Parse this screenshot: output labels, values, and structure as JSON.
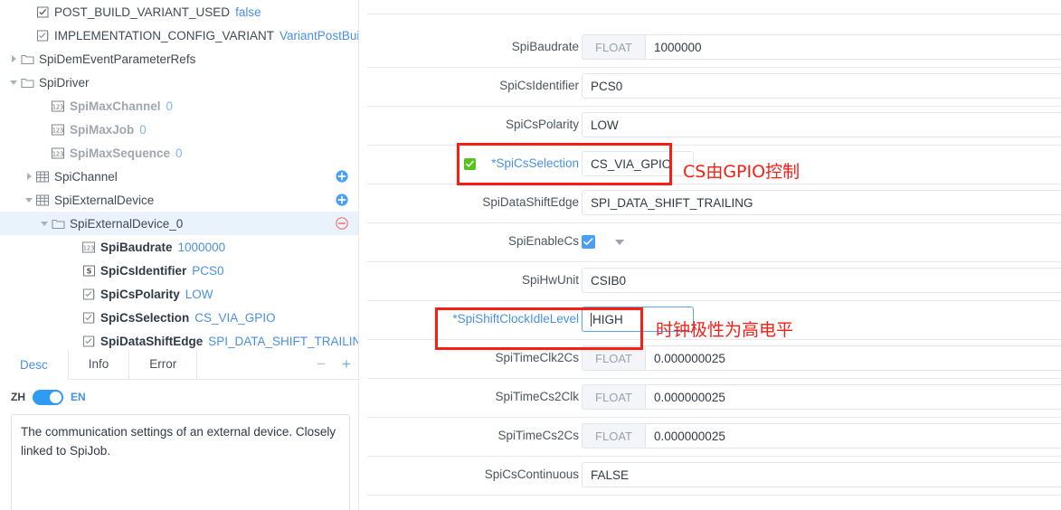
{
  "left_panel": {
    "tree": [
      {
        "indent": 1,
        "twisty": "none",
        "icon": "checkbox-checked-icon",
        "label": "POST_BUILD_VARIANT_USED",
        "value": "false",
        "style": "normal",
        "action": "none"
      },
      {
        "indent": 1,
        "twisty": "none",
        "icon": "enum-icon",
        "label": "IMPLEMENTATION_CONFIG_VARIANT",
        "value": "VariantPostBuild",
        "style": "normal",
        "action": "none"
      },
      {
        "indent": 0,
        "twisty": "right",
        "icon": "folder-icon",
        "label": "SpiDemEventParameterRefs",
        "value": "",
        "style": "normal",
        "action": "none"
      },
      {
        "indent": 0,
        "twisty": "down",
        "icon": "folder-icon",
        "label": "SpiDriver",
        "value": "",
        "style": "normal",
        "action": "none"
      },
      {
        "indent": 2,
        "twisty": "none",
        "icon": "number-icon",
        "label": "SpiMaxChannel",
        "value": "0",
        "style": "muted",
        "action": "none"
      },
      {
        "indent": 2,
        "twisty": "none",
        "icon": "number-icon",
        "label": "SpiMaxJob",
        "value": "0",
        "style": "muted",
        "action": "none"
      },
      {
        "indent": 2,
        "twisty": "none",
        "icon": "number-icon",
        "label": "SpiMaxSequence",
        "value": "0",
        "style": "muted",
        "action": "none"
      },
      {
        "indent": 1,
        "twisty": "right",
        "icon": "table-icon",
        "label": "SpiChannel",
        "value": "",
        "style": "normal",
        "action": "add"
      },
      {
        "indent": 1,
        "twisty": "down",
        "icon": "table-icon",
        "label": "SpiExternalDevice",
        "value": "",
        "style": "normal",
        "action": "add"
      },
      {
        "indent": 2,
        "twisty": "down",
        "icon": "folder-icon",
        "label": "SpiExternalDevice_0",
        "value": "",
        "style": "selected",
        "action": "remove"
      },
      {
        "indent": 4,
        "twisty": "none",
        "icon": "number-icon",
        "label": "SpiBaudrate",
        "value": "1000000",
        "style": "bold",
        "action": "none"
      },
      {
        "indent": 4,
        "twisty": "none",
        "icon": "string-icon",
        "label": "SpiCsIdentifier",
        "value": "PCS0",
        "style": "bold",
        "action": "none"
      },
      {
        "indent": 4,
        "twisty": "none",
        "icon": "enum-icon",
        "label": "SpiCsPolarity",
        "value": "LOW",
        "style": "bold",
        "action": "none"
      },
      {
        "indent": 4,
        "twisty": "none",
        "icon": "enum-icon",
        "label": "SpiCsSelection",
        "value": "CS_VIA_GPIO",
        "style": "bold",
        "action": "none"
      },
      {
        "indent": 4,
        "twisty": "none",
        "icon": "enum-icon",
        "label": "SpiDataShiftEdge",
        "value": "SPI_DATA_SHIFT_TRAILING",
        "style": "bold",
        "action": "none"
      }
    ],
    "tabs": [
      {
        "label": "Desc",
        "active": true
      },
      {
        "label": "Info",
        "active": false
      },
      {
        "label": "Error",
        "active": false
      }
    ],
    "tab_actions": {
      "collapse": "−",
      "expand": "+"
    },
    "language": {
      "left": "ZH",
      "right": "EN"
    },
    "description": "The communication settings of an external device. Closely linked to SpiJob."
  },
  "form": {
    "rows": [
      {
        "label": "SpiBaudrate",
        "required": false,
        "checked": false,
        "addon": "FLOAT",
        "value": "1000000",
        "kind": "input"
      },
      {
        "label": "SpiCsIdentifier",
        "required": false,
        "checked": false,
        "addon": "",
        "value": "PCS0",
        "kind": "input"
      },
      {
        "label": "SpiCsPolarity",
        "required": false,
        "checked": false,
        "addon": "",
        "value": "LOW",
        "kind": "input"
      },
      {
        "label": "SpiCsSelection",
        "required": true,
        "checked": true,
        "addon": "",
        "value": "CS_VIA_GPIO",
        "kind": "input-short"
      },
      {
        "label": "SpiDataShiftEdge",
        "required": false,
        "checked": false,
        "addon": "",
        "value": "SPI_DATA_SHIFT_TRAILING",
        "kind": "input"
      },
      {
        "label": "SpiEnableCs",
        "required": false,
        "checked": false,
        "addon": "",
        "value": "",
        "kind": "checkbox"
      },
      {
        "label": "SpiHwUnit",
        "required": false,
        "checked": false,
        "addon": "",
        "value": "CSIB0",
        "kind": "input"
      },
      {
        "label": "SpiShiftClockIdleLevel",
        "required": true,
        "checked": false,
        "addon": "",
        "value": "HIGH",
        "kind": "input-focused"
      },
      {
        "label": "SpiTimeClk2Cs",
        "required": false,
        "checked": false,
        "addon": "FLOAT",
        "value": "0.000000025",
        "kind": "input"
      },
      {
        "label": "SpiTimeCs2Clk",
        "required": false,
        "checked": false,
        "addon": "FLOAT",
        "value": "0.000000025",
        "kind": "input"
      },
      {
        "label": "SpiTimeCs2Cs",
        "required": false,
        "checked": false,
        "addon": "FLOAT",
        "value": "0.000000025",
        "kind": "input"
      },
      {
        "label": "SpiCsContinuous",
        "required": false,
        "checked": false,
        "addon": "",
        "value": "FALSE",
        "kind": "input"
      }
    ]
  },
  "annotations": [
    {
      "text": "CS由GPIO控制"
    },
    {
      "text": "时钟极性为高电平"
    }
  ],
  "colors": {
    "accent": "#4a90e2",
    "annotation": "#f81e14",
    "green_check": "#52c41a",
    "selected_row": "#eaf3fc"
  }
}
